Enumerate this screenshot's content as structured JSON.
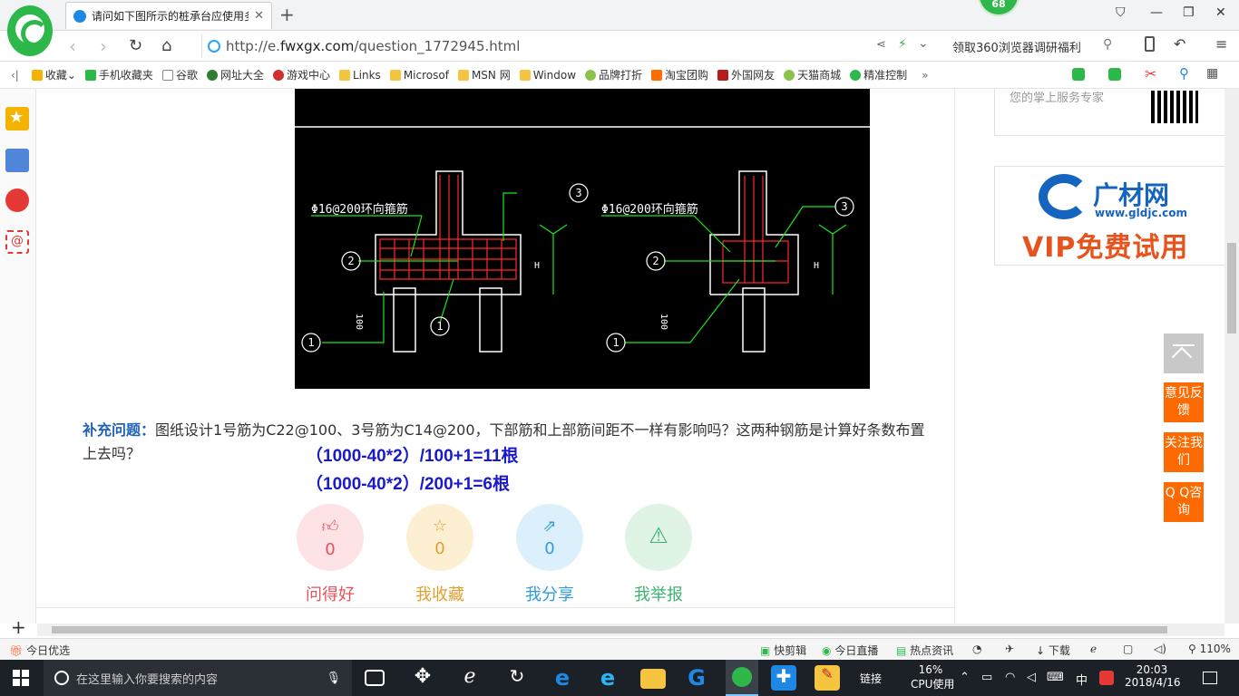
{
  "browser": {
    "tab_title": "请问如下图所示的桩承台应使用多",
    "badge": "68",
    "url_prefix": "http://e.",
    "url_domain": "fwxgx.com",
    "url_path": "/question_1772945.html",
    "promo": "领取360浏览器调研福利"
  },
  "bookmarks": [
    {
      "label": "收藏"
    },
    {
      "label": "手机收藏夹"
    },
    {
      "label": "谷歌"
    },
    {
      "label": "网址大全"
    },
    {
      "label": "游戏中心"
    },
    {
      "label": "Links"
    },
    {
      "label": "Microsof"
    },
    {
      "label": "MSN 网"
    },
    {
      "label": "Window"
    },
    {
      "label": "品牌打折"
    },
    {
      "label": "淘宝团购"
    },
    {
      "label": "外国网友"
    },
    {
      "label": "天猫商城"
    },
    {
      "label": "精准控制"
    }
  ],
  "drawing": {
    "note_left": "Φ16@200环向箍筋",
    "note_right": "Φ16@200环向箍筋",
    "dim_h": "H",
    "dim_100": "100",
    "markers": [
      "1",
      "2",
      "3"
    ]
  },
  "question": {
    "label": "补充问题：",
    "text": "图纸设计1号筋为C22@100、3号筋为C14@200，下部筋和上部筋间距不一样有影响吗？这两种钢筋是计算好条数布置上去吗？",
    "formula1": "（1000-40*2）/100+1=11根",
    "formula2": "（1000-40*2）/200+1=6根"
  },
  "actions": [
    {
      "count": "0",
      "label": "问得好",
      "color": "#e8505b",
      "bg": "#fde3e6"
    },
    {
      "count": "0",
      "label": "我收藏",
      "color": "#e0a030",
      "bg": "#fdefd2"
    },
    {
      "count": "0",
      "label": "我分享",
      "color": "#2f9bdc",
      "bg": "#dcf0fb"
    },
    {
      "count": "0",
      "label": "我举报",
      "color": "#3cb371",
      "bg": "#dff4e4"
    }
  ],
  "right": {
    "ad_top_text": "您的掌上服务专家",
    "ad2_name": "广材网",
    "ad2_url": "www.gldjc.com",
    "ad2_vip": "VIP免费试用",
    "feedback": "意见反馈",
    "follow": "关注我们",
    "qq": "Q Q咨询"
  },
  "statusbar": {
    "left": "今日优选",
    "items": [
      "快剪辑",
      "今日直播",
      "热点资讯",
      "下载"
    ],
    "zoom": "110%"
  },
  "taskbar": {
    "search_placeholder": "在这里输入你要搜索的内容",
    "links": "链接",
    "cpu_pct": "16%",
    "cpu_label": "CPU使用",
    "ime": "中",
    "time": "20:03",
    "date": "2018/4/16"
  }
}
